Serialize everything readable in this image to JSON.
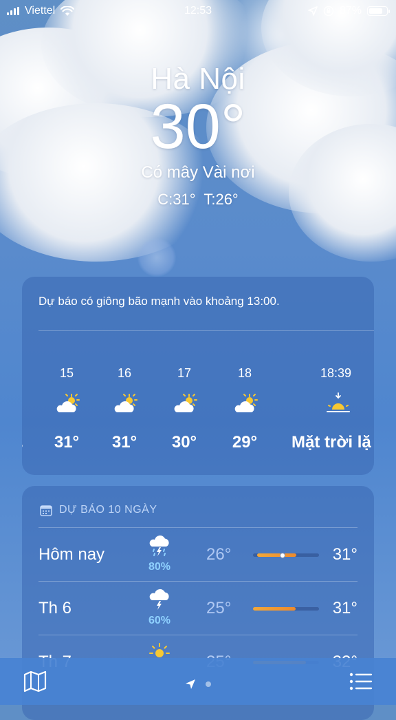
{
  "status_bar": {
    "carrier": "Viettel",
    "time": "12:53",
    "battery_percent": "87%",
    "battery_level": 0.87,
    "signal_icon": "signal-bars-icon",
    "wifi_icon": "wifi-icon",
    "location_icon": "location-arrow-icon",
    "rotation_lock_icon": "rotation-lock-icon"
  },
  "header": {
    "city": "Hà Nội",
    "temperature": "30°",
    "condition": "Có mây Vài nơi",
    "high_low": "C:31°  T:26°"
  },
  "hourly": {
    "alert": "Dự báo có giông bão mạnh vào khoảng 13:00.",
    "hours": [
      {
        "time": "15",
        "icon": "partly-cloudy-icon",
        "temp": "31°"
      },
      {
        "time": "16",
        "icon": "partly-cloudy-icon",
        "temp": "31°"
      },
      {
        "time": "17",
        "icon": "partly-cloudy-icon",
        "temp": "30°"
      },
      {
        "time": "18",
        "icon": "partly-cloudy-icon",
        "temp": "29°"
      },
      {
        "time": "18:39",
        "icon": "sunset-icon",
        "temp": "Mặt trời lặ"
      }
    ]
  },
  "ten_day": {
    "heading": "DỰ BÁO 10 NGÀY",
    "heading_icon": "calendar-icon",
    "days": [
      {
        "day": "Hôm nay",
        "icon": "thunderstorm-rain-icon",
        "precip": "80%",
        "low": "26°",
        "high": "31°",
        "range_start": 0.0,
        "range_end": 0.6,
        "current": 0.45
      },
      {
        "day": "Th 6",
        "icon": "thunderstorm-icon",
        "precip": "60%",
        "low": "25°",
        "high": "31°",
        "range_start": 0.0,
        "range_end": 0.65
      },
      {
        "day": "Th 7",
        "icon": "sun-icon",
        "precip": "",
        "low": "25°",
        "high": "32°",
        "range_start": 0.0,
        "range_end": 0.8
      }
    ]
  },
  "bottom_bar": {
    "map_icon": "map-icon",
    "location_icon": "location-arrow-icon",
    "list_icon": "list-icon"
  },
  "colors": {
    "bar_fill": "#ee8a2c",
    "precip_text": "#8fd1ff",
    "sun": "#f7c832"
  }
}
